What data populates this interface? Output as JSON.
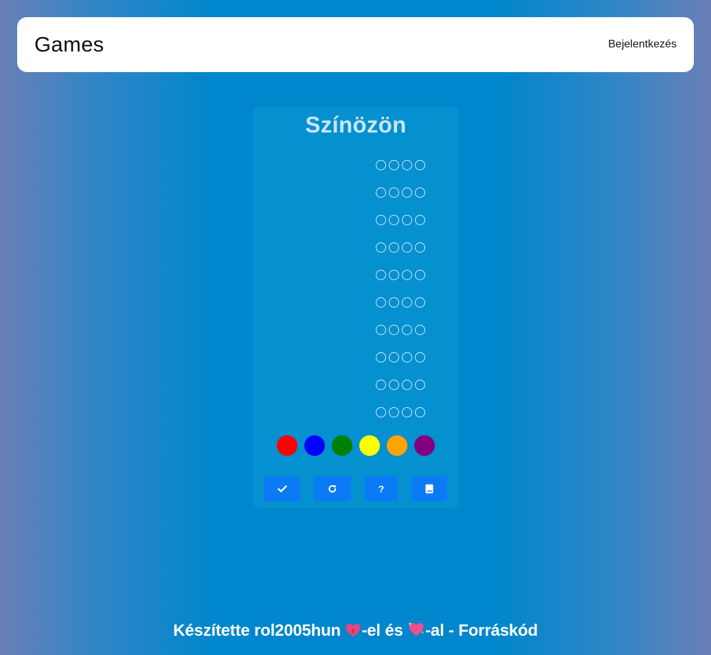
{
  "navbar": {
    "brand": "Games",
    "login_label": "Bejelentkezés"
  },
  "game": {
    "title": "Színözön",
    "guess_rows": 10,
    "pegs_per_row": 4,
    "palette": [
      {
        "name": "red",
        "color": "#ff0000"
      },
      {
        "name": "blue",
        "color": "#0000ff"
      },
      {
        "name": "green",
        "color": "#008000"
      },
      {
        "name": "yellow",
        "color": "#ffff00"
      },
      {
        "name": "orange",
        "color": "#ffa500"
      },
      {
        "name": "purple",
        "color": "#800080"
      }
    ],
    "buttons": [
      {
        "name": "submit-guess-button",
        "icon": "check-icon"
      },
      {
        "name": "restart-button",
        "icon": "redo-icon"
      },
      {
        "name": "help-button",
        "icon": "question-icon"
      },
      {
        "name": "rules-button",
        "icon": "book-icon"
      }
    ]
  },
  "footer": {
    "made_by": "Készítette rol2005hun",
    "love_suffix": "-el és",
    "sparkle_suffix": "-al -",
    "source_link": "Forráskód",
    "heart_icon": "red-heart-icon",
    "sparkling_heart_icon": "sparkling-heart-icon"
  },
  "colors": {
    "accent_button": "#0a7bf5",
    "card_bg": "#0590d0",
    "title_color": "#c8e6f7"
  }
}
